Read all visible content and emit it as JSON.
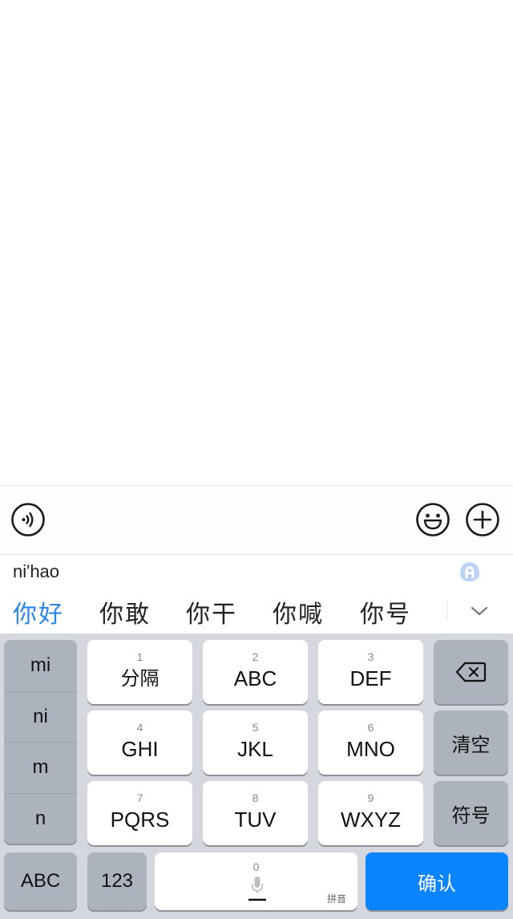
{
  "input_bar": {
    "voice_icon": "voice-wave-icon",
    "emoji_icon": "smiley-icon",
    "plus_icon": "plus-circle-icon"
  },
  "ime": {
    "composition": "ni'hao",
    "logo_icon": "ime-brand-icon",
    "candidates": [
      {
        "text": "你好",
        "selected": true
      },
      {
        "text": "你敢",
        "selected": false
      },
      {
        "text": "你干",
        "selected": false
      },
      {
        "text": "你喊",
        "selected": false
      },
      {
        "text": "你号",
        "selected": false
      }
    ],
    "expand_icon": "chevron-down-icon",
    "syllables": [
      "mi",
      "ni",
      "m",
      "n"
    ],
    "keys": [
      {
        "num": "1",
        "label": "分隔"
      },
      {
        "num": "2",
        "label": "ABC"
      },
      {
        "num": "3",
        "label": "DEF"
      },
      {
        "num": "4",
        "label": "GHI"
      },
      {
        "num": "5",
        "label": "JKL"
      },
      {
        "num": "6",
        "label": "MNO"
      },
      {
        "num": "7",
        "label": "PQRS"
      },
      {
        "num": "8",
        "label": "TUV"
      },
      {
        "num": "9",
        "label": "WXYZ"
      }
    ],
    "function_keys": {
      "backspace_icon": "backspace-icon",
      "clear": "清空",
      "symbols": "符号",
      "abc": "ABC",
      "num": "123",
      "space_num": "0",
      "space_mic_icon": "microphone-icon",
      "space_tag": "拼音",
      "confirm": "确认"
    },
    "colors": {
      "selected_candidate": "#2a86e8",
      "confirm_key": "#0a84ff"
    }
  }
}
